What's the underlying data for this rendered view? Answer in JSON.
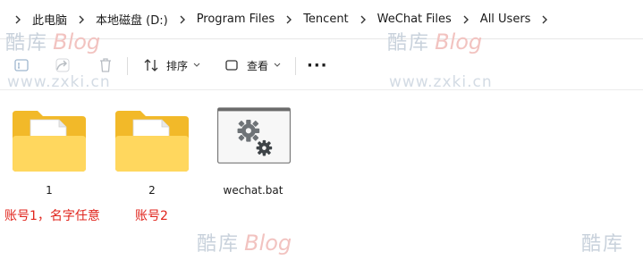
{
  "breadcrumb": {
    "items": [
      "此电脑",
      "本地磁盘 (D:)",
      "Program Files",
      "Tencent",
      "WeChat Files",
      "All Users"
    ]
  },
  "toolbar": {
    "sort_label": "排序",
    "view_label": "查看",
    "more_label": "···"
  },
  "files": [
    {
      "name": "1",
      "type": "folder"
    },
    {
      "name": "2",
      "type": "folder"
    },
    {
      "name": "wechat.bat",
      "type": "batch-file"
    }
  ],
  "annotations": {
    "note1": "账号1，名字任意",
    "note2": "账号2"
  },
  "watermark": {
    "cn": "酷库",
    "en": "Blog",
    "url": "www.zxki.cn"
  },
  "colors": {
    "folder_back": "#f2b929",
    "folder_front": "#ffd75e",
    "annotation": "#e0241c",
    "gear": "#6e7377"
  }
}
